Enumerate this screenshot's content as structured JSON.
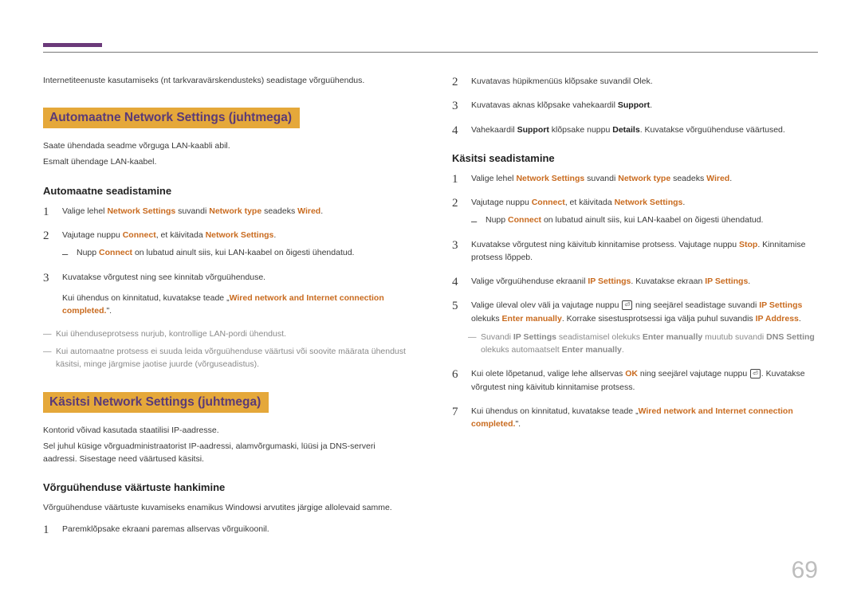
{
  "page_number": "69",
  "left": {
    "intro": "Internetiteenuste kasutamiseks (nt tarkvaravärskendusteks) seadistage võrguühendus.",
    "heading1": "Automaatne Network Settings (juhtmega)",
    "p1a": "Saate ühendada seadme võrguga LAN-kaabli abil.",
    "p1b": "Esmalt ühendage LAN-kaabel.",
    "sub1": "Automaatne seadistamine",
    "s1": {
      "t1a": "Valige lehel ",
      "t1b": "Network Settings",
      "t1c": " suvandi ",
      "t1d": "Network type",
      "t1e": " seadeks ",
      "t1f": "Wired",
      "t1g": "."
    },
    "s2": {
      "t2a": "Vajutage nuppu ",
      "t2b": "Connect",
      "t2c": ", et käivitada ",
      "t2d": "Network Settings",
      "t2e": "."
    },
    "s2n": {
      "na": "Nupp ",
      "nb": "Connect",
      "nc": " on lubatud ainult siis, kui LAN-kaabel on õigesti ühendatud."
    },
    "s3": {
      "t3a": "Kuvatakse võrgutest ning see kinnitab võrguühenduse.",
      "t3b": "Kui ühendus on kinnitatud, kuvatakse teade „",
      "t3c": "Wired network and Internet connection completed.",
      "t3d": "\"."
    },
    "n1": "Kui ühenduseprotsess nurjub, kontrollige LAN-pordi ühendust.",
    "n2": "Kui automaatne protsess ei suuda leida võrguühenduse väärtusi või soovite määrata ühendust käsitsi, minge järgmise jaotise juurde (võrguseadistus).",
    "heading2": "Käsitsi Network Settings (juhtmega)",
    "p2a": "Kontorid võivad kasutada staatilisi IP-aadresse.",
    "p2b": "Sel juhul küsige võrguadministraatorist IP-aadressi, alamvõrgumaski, lüüsi ja DNS-serveri aadressi. Sisestage need väärtused käsitsi.",
    "sub2": "Võrguühenduse väärtuste hankimine",
    "p3": "Võrguühenduse väärtuste kuvamiseks enamikus Windowsi arvutites järgige allolevaid samme.",
    "s4": {
      "t": "Paremklõpsake ekraani paremas allservas võrguikoonil."
    }
  },
  "right": {
    "s2": {
      "t": "Kuvatavas hüpikmenüüs klõpsake suvandil Olek."
    },
    "s3": {
      "ta": "Kuvatavas aknas klõpsake vahekaardil ",
      "tb": "Support",
      "tc": "."
    },
    "s4": {
      "ta": "Vahekaardil ",
      "tb": "Support",
      "tc": " klõpsake nuppu ",
      "td": "Details",
      "te": ". Kuvatakse võrguühenduse väärtused."
    },
    "sub": "Käsitsi seadistamine",
    "k1": {
      "a": "Valige lehel ",
      "b": "Network Settings",
      "c": " suvandi ",
      "d": "Network type",
      "e": " seadeks ",
      "f": "Wired",
      "g": "."
    },
    "k2": {
      "a": "Vajutage nuppu ",
      "b": "Connect",
      "c": ", et käivitada ",
      "d": "Network Settings",
      "e": "."
    },
    "k2n": {
      "a": "Nupp ",
      "b": "Connect",
      "c": " on lubatud ainult siis, kui LAN-kaabel on õigesti ühendatud."
    },
    "k3": {
      "a": "Kuvatakse võrgutest ning käivitub kinnitamise protsess. Vajutage nuppu ",
      "b": "Stop",
      "c": ". Kinnitamise protsess lõppeb."
    },
    "k4": {
      "a": "Valige võrguühenduse ekraanil ",
      "b": "IP Settings",
      "c": ". Kuvatakse ekraan ",
      "d": "IP Settings",
      "e": "."
    },
    "k5": {
      "a": "Valige üleval olev väli ja vajutage nuppu ",
      "b": " ning seejärel seadistage suvandi ",
      "c": "IP Settings",
      "d": " olekuks ",
      "e": "Enter manually",
      "f": ". Korrake sisestusprotsessi iga välja puhul suvandis ",
      "g": "IP Address",
      "h": "."
    },
    "k5n": {
      "a": "Suvandi ",
      "b": "IP Settings",
      "c": " seadistamisel olekuks ",
      "d": "Enter manually",
      "e": " muutub suvandi ",
      "f": "DNS Setting",
      "g": " olekuks automaatselt ",
      "h": "Enter manually",
      "i": "."
    },
    "k6": {
      "a": "Kui olete lõpetanud, valige lehe allservas ",
      "b": "OK",
      "c": " ning seejärel vajutage nuppu ",
      "d": ". Kuvatakse võrgutest ning käivitub kinnitamise protsess."
    },
    "k7": {
      "a": "Kui ühendus on kinnitatud, kuvatakse teade „",
      "b": "Wired network and Internet connection completed.",
      "c": "\"."
    }
  }
}
